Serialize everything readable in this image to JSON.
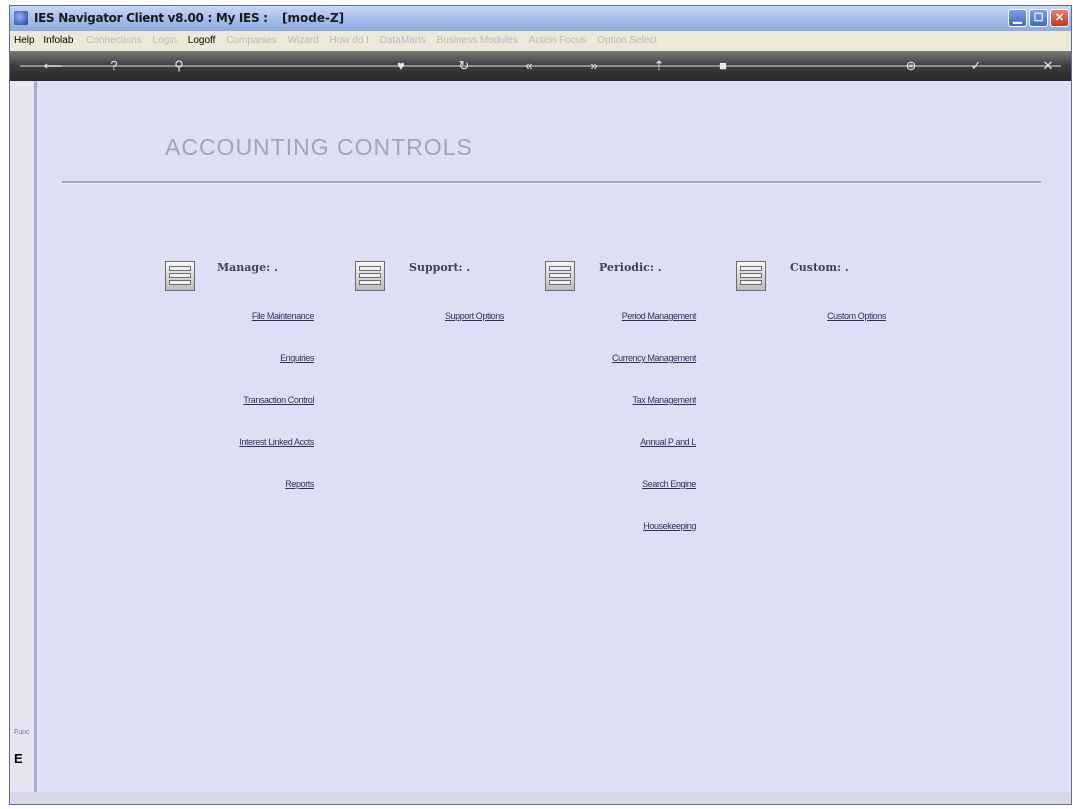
{
  "window": {
    "title": "IES Navigator Client v8.00 : My IES :",
    "mode": "[mode-Z]",
    "min_icon": "minimize-icon",
    "max_icon": "maximize-icon",
    "close_icon": "close-icon"
  },
  "menu": {
    "items": [
      "Help",
      "Infolab",
      "Connections",
      "Login",
      "Logoff",
      "Companies",
      "Wizard",
      "How do I",
      "DataMarts",
      "Business Modules",
      "Action Focus",
      "Option Select"
    ],
    "active_items": [
      "Help",
      "Infolab",
      "Logoff"
    ]
  },
  "toolbar": {
    "icons": [
      "back-arrow-icon",
      "help-icon",
      "search-icon",
      "favorite-icon",
      "refresh-icon",
      "rewind-icon",
      "forward-icon",
      "upload-icon",
      "stop-icon",
      "settings-icon",
      "ok-icon",
      "exit-icon"
    ]
  },
  "page": {
    "title": "ACCOUNTING CONTROLS"
  },
  "sections": [
    {
      "title": "Manage: .",
      "links": [
        "File Maintenance",
        "Enquiries",
        "Transaction Control",
        "Interest Linked Accts",
        "Reports"
      ]
    },
    {
      "title": "Support: .",
      "links": [
        "Support Options"
      ]
    },
    {
      "title": "Periodic: .",
      "links": [
        "Period Management",
        "Currency Management",
        "Tax Management",
        "Annual P and L",
        "Search Engine",
        "Housekeeping"
      ]
    },
    {
      "title": "Custom: .",
      "links": [
        "Custom Options"
      ]
    }
  ],
  "sidebar": {
    "label": "Func",
    "letter": "E"
  },
  "colors": {
    "content_bg": "#dedff4",
    "toolbar_bg": "#3c3c3c",
    "titlebar_bg": "#a9c0ec"
  }
}
